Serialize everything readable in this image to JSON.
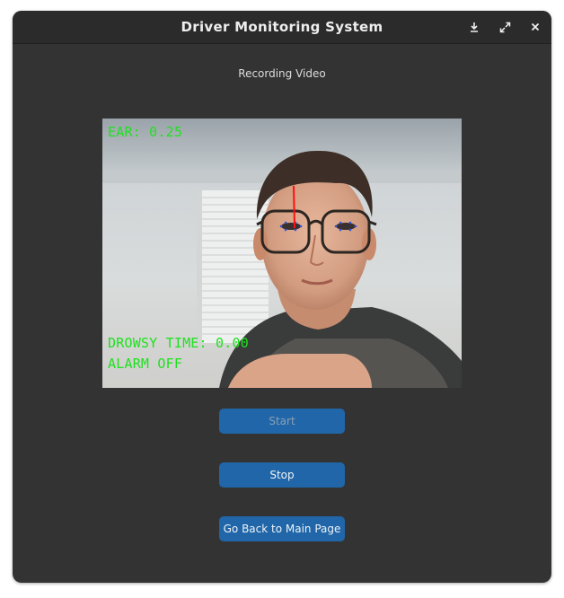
{
  "window": {
    "title": "Driver Monitoring System",
    "icons": [
      "download-icon",
      "maximize-icon",
      "close-icon"
    ]
  },
  "main": {
    "subtitle": "Recording Video",
    "video_overlay": {
      "ear": "EAR: 0.25",
      "drowsy_time": "DROWSY TIME: 0.00",
      "alarm": "ALARM OFF",
      "overlay_color": "#1fe01f"
    },
    "buttons": {
      "start": "Start",
      "stop": "Stop",
      "back": "Go Back to Main Page"
    }
  },
  "colors": {
    "window_bg": "#333333",
    "titlebar_bg": "#2b2b2b",
    "button_bg": "#2066a8"
  }
}
